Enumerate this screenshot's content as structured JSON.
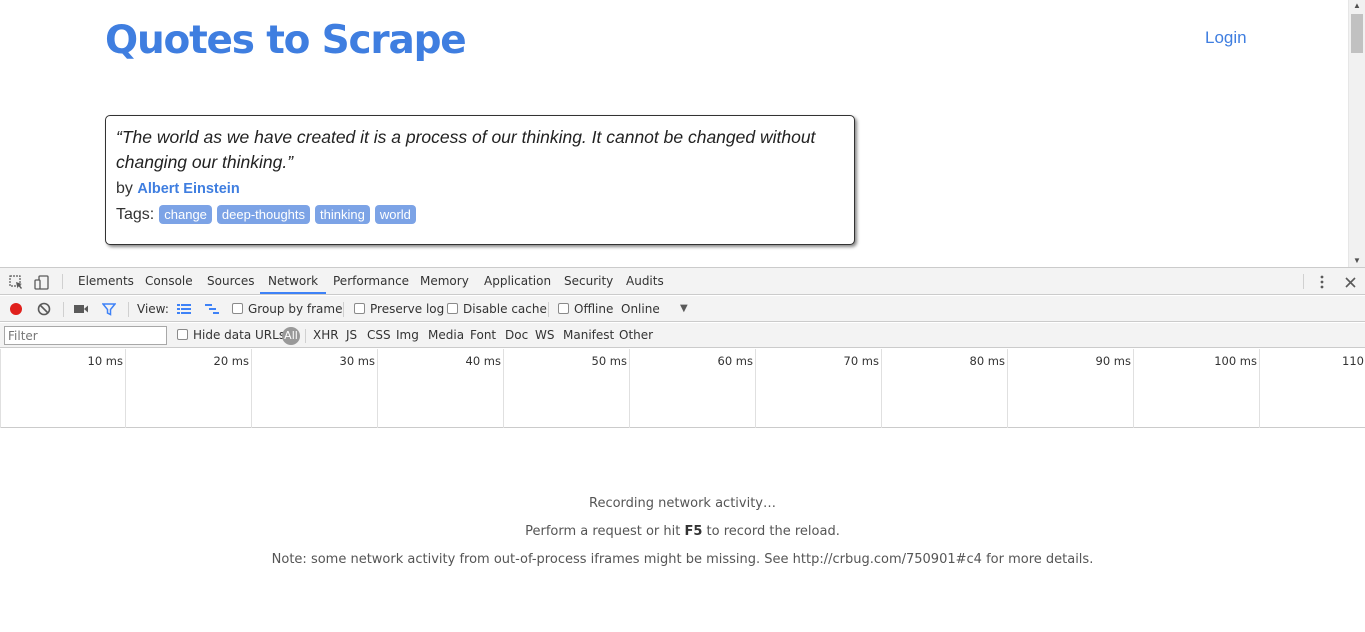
{
  "site": {
    "title": "Quotes to Scrape",
    "login_label": "Login"
  },
  "quote": {
    "text": "“The world as we have created it is a process of our thinking. It cannot be changed without changing our thinking.”",
    "by_label": "by",
    "author": "Albert Einstein",
    "tags_label": "Tags:",
    "tags": [
      "change",
      "deep-thoughts",
      "thinking",
      "world"
    ]
  },
  "devtools": {
    "tabs": [
      "Elements",
      "Console",
      "Sources",
      "Network",
      "Performance",
      "Memory",
      "Application",
      "Security",
      "Audits"
    ],
    "active_tab": "Network",
    "toolbar": {
      "view_label": "View:",
      "group_by_frame": "Group by frame",
      "preserve_log": "Preserve log",
      "disable_cache": "Disable cache",
      "offline": "Offline",
      "throttle": "Online"
    },
    "filter": {
      "placeholder": "Filter",
      "hide_data_urls": "Hide data URLs",
      "types": [
        "All",
        "XHR",
        "JS",
        "CSS",
        "Img",
        "Media",
        "Font",
        "Doc",
        "WS",
        "Manifest",
        "Other"
      ]
    },
    "timeline_ticks": [
      "10 ms",
      "20 ms",
      "30 ms",
      "40 ms",
      "50 ms",
      "60 ms",
      "70 ms",
      "80 ms",
      "90 ms",
      "100 ms",
      "110"
    ],
    "messages": {
      "recording": "Recording network activity…",
      "perform_pre": "Perform a request or hit",
      "perform_key": "F5",
      "perform_post": "to record the reload.",
      "note": "Note: some network activity from out-of-process iframes might be missing. See http://crbug.com/750901#c4 for more details."
    }
  },
  "colors": {
    "brand": "#3f7ee0",
    "tag_bg": "#7ca3e6",
    "record": "#e0201c",
    "active_tab_underline": "#3e82f7"
  }
}
